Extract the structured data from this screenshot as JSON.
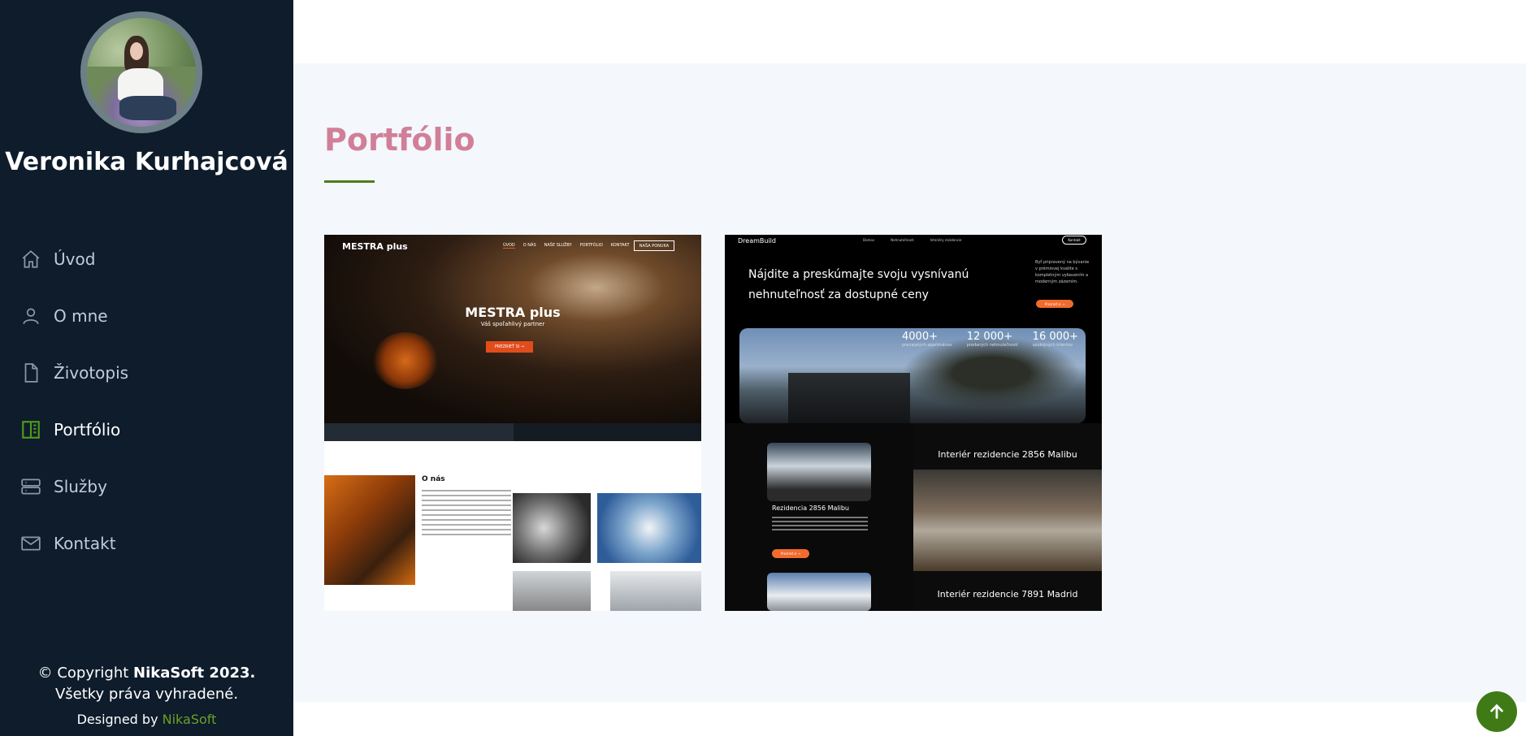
{
  "sidebar": {
    "name": "Veronika Kurhajcová",
    "nav": [
      {
        "label": "Úvod",
        "icon": "home-icon",
        "active": false
      },
      {
        "label": "O mne",
        "icon": "user-icon",
        "active": false
      },
      {
        "label": "Životopis",
        "icon": "file-icon",
        "active": false
      },
      {
        "label": "Portfólio",
        "icon": "book-icon",
        "active": true
      },
      {
        "label": "Služby",
        "icon": "server-icon",
        "active": false
      },
      {
        "label": "Kontakt",
        "icon": "envelope-icon",
        "active": false
      }
    ],
    "footer": {
      "copyright_prefix": "© Copyright ",
      "copyright_brand": "NikaSoft 2023.",
      "rights": "Všetky práva vyhradené.",
      "designed_by": "Designed by ",
      "designer": "NikaSoft"
    }
  },
  "main": {
    "section_title": "Portfólio",
    "cards": [
      {
        "logo": "MESTRA plus",
        "nav": [
          "ÚVOD",
          "O NÁS",
          "NAŠE SLUŽBY",
          "PORTFÓLIO",
          "KONTAKT"
        ],
        "cta_top": "NAŠA PONUKA",
        "headline": "MESTRA plus",
        "subline": "Váš spoľahlivý partner",
        "cta": "PREZRIEŤ SI →",
        "about_title": "O nás"
      },
      {
        "logo": "DreamBuild",
        "nav": [
          "Domov",
          "Nehnuteľnosti",
          "Interiéry rezidencie"
        ],
        "contact": "Kontakt",
        "headline": "Nájdite a preskúmajte svoju vysnívanú nehnuteľnosť za dostupné ceny",
        "side_text": "Byť pripravený na bývanie v prémiovej kvalite s kompletným vybavením a moderným zázemím.",
        "orange_btn": "Prezrieť si →",
        "stats": [
          {
            "value": "4000+",
            "label": "prenajatých apartmánov"
          },
          {
            "value": "12 000+",
            "label": "predaných nehnuteľností"
          },
          {
            "value": "16 000+",
            "label": "spokojných klientov"
          }
        ],
        "tile_title": "Rezidencia 2856 Malibu",
        "tile_btn": "Prezrieť si →",
        "interior_1": "Interiér rezidencie 2856 Malibu",
        "interior_2": "Interiér rezidencie 7891 Madrid"
      }
    ]
  },
  "colors": {
    "sidebar_bg": "#0e1c2c",
    "title": "#d17f98",
    "accent_green": "#4f7d1a",
    "to_top_bg": "#3f7a17"
  }
}
